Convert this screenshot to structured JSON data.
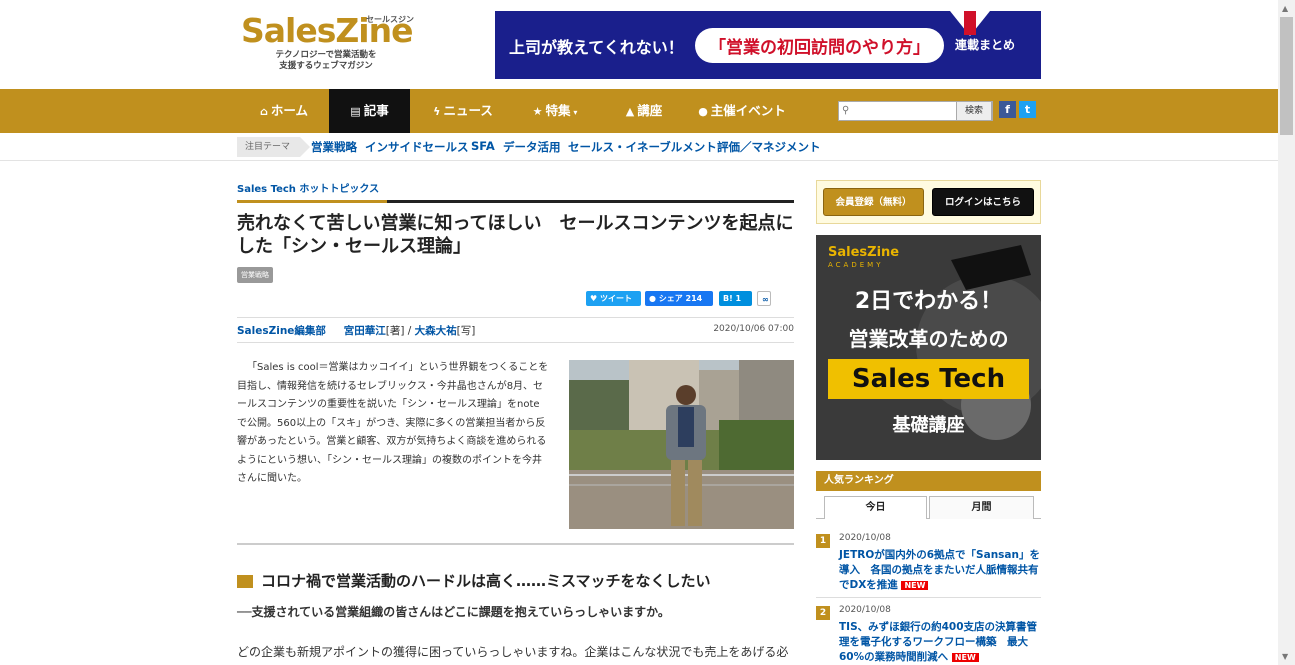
{
  "header": {
    "logo_brand": "SalesZine",
    "logo_kana": "セールスジン",
    "logo_tagline_1": "テクノロジーで営業活動を",
    "logo_tagline_2": "支援するウェブマガジン",
    "banner_text_1": "上司が教えてくれない！",
    "banner_text_2": "「営業の初回訪問のやり方」",
    "banner_text_3": "連載まとめ"
  },
  "nav": {
    "items": [
      {
        "label": "ホーム",
        "icon": "home-icon"
      },
      {
        "label": "記事",
        "icon": "document-icon"
      },
      {
        "label": "ニュース",
        "icon": "bolt-icon"
      },
      {
        "label": "特集",
        "icon": "star-icon"
      },
      {
        "label": "講座",
        "icon": "graduation-cap-icon"
      },
      {
        "label": "主催イベント",
        "icon": "microphone-icon"
      }
    ],
    "active_index": 1,
    "search_button": "検索",
    "search_value": "",
    "accent_color": "#c0901e"
  },
  "themes": {
    "label": "注目テーマ",
    "items": [
      "営業戦略",
      "インサイドセールス",
      "SFA",
      "データ活用",
      "セールス・イネーブルメント",
      "評価／マネジメント"
    ]
  },
  "article": {
    "section": "Sales Tech ホットトピックス",
    "title": "売れなくて苦しい営業に知ってほしい　セールスコンテンツを起点にした「シン・セールス理論」",
    "tag": "営業戦略",
    "share_tweet": "ツイート",
    "share_fb": "シェア 214",
    "share_hatena": "B! 1",
    "byline_author": "SalesZine編集部",
    "byline_writer": "宮田華江",
    "byline_writer_role": "[著]",
    "byline_sep": " / ",
    "byline_photo": "大森大祐",
    "byline_photo_role": "[写]",
    "date": "2020/10/06 07:00",
    "lead": "「Sales is cool＝営業はカッコイイ」という世界観をつくることを目指し、情報発信を続けるセレブリックス・今井晶也さんが8月、セールスコンテンツの重要性を説いた「シン・セールス理論」をnoteで公開。560以上の「スキ」がつき、実際に多くの営業担当者から反響があったという。営業と顧客、双方が気持ちよく商談を進められるようにという想い、「シン・セールス理論」の複数のポイントを今井さんに聞いた。",
    "h2": "コロナ禍で営業活動のハードルは高く……ミスマッチをなくしたい",
    "question": "──支援されている営業組織の皆さんはどこに課題を抱えていらっしゃいますか。",
    "body": "どの企業も新規アポイントの獲得に困っていらっしゃいますね。企業はこんな状況でも売上をあげる必"
  },
  "sidebar": {
    "register_button": "会員登録（無料）",
    "login_button": "ログインはこちら",
    "ad_logo": "SalesZine",
    "ad_logo_sub": "ACADEMY",
    "ad_line1": "2日でわかる！",
    "ad_line2": "営業改革のための",
    "ad_line3": "Sales Tech",
    "ad_line4": "基礎講座",
    "ranking_title": "人気ランキング",
    "tab_today": "今日",
    "tab_month": "月間",
    "ranking": [
      {
        "num": "1",
        "date": "2020/10/08",
        "title": "JETROが国内外の6拠点で「Sansan」を導入　各国の拠点をまたいだ人脈情報共有でDXを推進",
        "badge": "NEW"
      },
      {
        "num": "2",
        "date": "2020/10/08",
        "title": "TIS、みずほ銀行の約400支店の決算書管理を電子化するワークフロー構築　最大60%の業務時間削減へ",
        "badge": "NEW"
      }
    ]
  }
}
